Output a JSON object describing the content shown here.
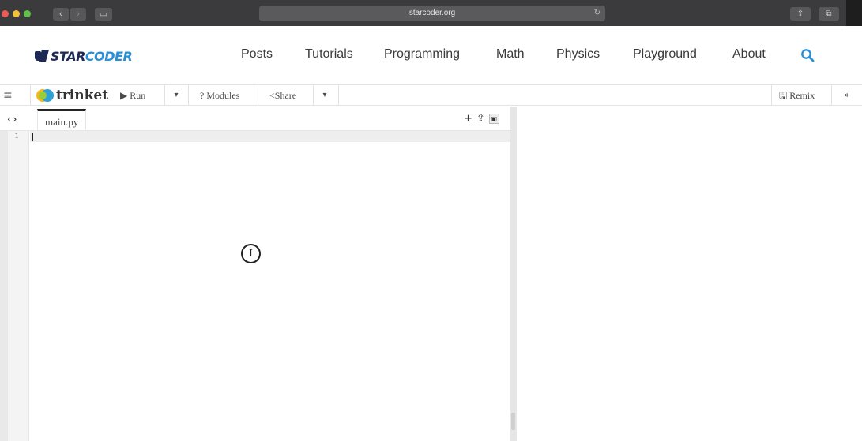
{
  "browser": {
    "url": "starcoder.org",
    "back": "‹",
    "forward": "›",
    "sidebar": "▭",
    "reload": "↻",
    "share": "⇪",
    "tabs": "⧉"
  },
  "site": {
    "logo_star": "STAR",
    "logo_coder": "CODER",
    "nav": {
      "posts": "Posts",
      "tutorials": "Tutorials",
      "programming": "Programming",
      "math": "Math",
      "physics": "Physics",
      "playground": "Playground",
      "about": "About"
    },
    "search_icon": "search-icon",
    "accent": "#2b8fd6"
  },
  "toolbar": {
    "menu": "≡",
    "logo": "trinket",
    "run": "▶ Run",
    "caret": "▾",
    "modules": "? Modules",
    "share": "<Share",
    "remix": "🖫 Remix",
    "exit": "⇥"
  },
  "editor": {
    "collapse": "‹›",
    "file_tab": "main.py",
    "add": "+",
    "upload": "⇪",
    "image_btn": "▣",
    "line_numbers": [
      "1"
    ],
    "code": ""
  }
}
